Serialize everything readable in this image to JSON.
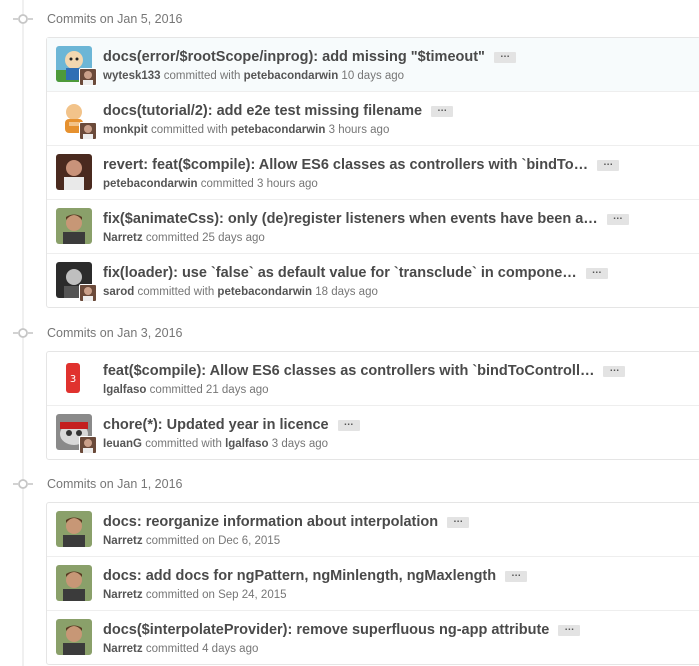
{
  "groups": [
    {
      "header": "Commits on Jan 5, 2016",
      "commits": [
        {
          "message": "docs(error/$rootScope/inprog): add missing \"$timeout\"",
          "author": "wytesk133",
          "mid": "committed with",
          "committer": "petebacondarwin",
          "time": "10 days ago",
          "avatar": "robot-avatar",
          "coauthor": true
        },
        {
          "message": "docs(tutorial/2): add e2e test missing filename",
          "author": "monkpit",
          "mid": "committed with",
          "committer": "petebacondarwin",
          "time": "3 hours ago",
          "avatar": "monk-avatar",
          "coauthor": true
        },
        {
          "message": "revert: feat($compile): Allow ES6 classes as controllers with `bindTo…",
          "author": "petebacondarwin",
          "mid": "committed",
          "committer": "",
          "time": "3 hours ago",
          "avatar": "petebacondarwin-avatar",
          "coauthor": false
        },
        {
          "message": "fix($animateCss): only (de)register listeners when events have been a…",
          "author": "Narretz",
          "mid": "committed",
          "committer": "",
          "time": "25 days ago",
          "avatar": "narretz-avatar",
          "coauthor": false
        },
        {
          "message": "fix(loader): use `false` as default value for `transclude` in compone…",
          "author": "sarod",
          "mid": "committed with",
          "committer": "petebacondarwin",
          "time": "18 days ago",
          "avatar": "sarod-avatar",
          "coauthor": true
        }
      ]
    },
    {
      "header": "Commits on Jan 3, 2016",
      "commits": [
        {
          "message": "feat($compile): Allow ES6 classes as controllers with `bindToControll…",
          "author": "lgalfaso",
          "mid": "committed",
          "committer": "",
          "time": "21 days ago",
          "avatar": "lgalfaso-avatar",
          "coauthor": false
        },
        {
          "message": "chore(*): Updated year in licence",
          "author": "IeuanG",
          "mid": "committed with",
          "committer": "lgalfaso",
          "time": "3 days ago",
          "avatar": "ieuang-avatar",
          "coauthor": true
        }
      ]
    },
    {
      "header": "Commits on Jan 1, 2016",
      "commits": [
        {
          "message": "docs: reorganize information about interpolation",
          "author": "Narretz",
          "mid": "committed on",
          "committer": "",
          "time": "Dec 6, 2015",
          "avatar": "narretz-avatar",
          "coauthor": false
        },
        {
          "message": "docs: add docs for ngPattern, ngMinlength, ngMaxlength",
          "author": "Narretz",
          "mid": "committed on",
          "committer": "",
          "time": "Sep 24, 2015",
          "avatar": "narretz-avatar",
          "coauthor": false
        },
        {
          "message": "docs($interpolateProvider): remove superfluous ng-app attribute",
          "author": "Narretz",
          "mid": "committed",
          "committer": "",
          "time": "4 days ago",
          "avatar": "narretz-avatar",
          "coauthor": false
        }
      ]
    }
  ],
  "ellipsis_label": "…",
  "icons": {
    "commit": "git-commit-icon",
    "expand": "ellipsis-icon"
  },
  "colors": {
    "timeline": "#f0f0f0",
    "border": "#e5e5e5",
    "highlight_row": "#f7fbfc",
    "button_bg": "#e3e3e3"
  }
}
